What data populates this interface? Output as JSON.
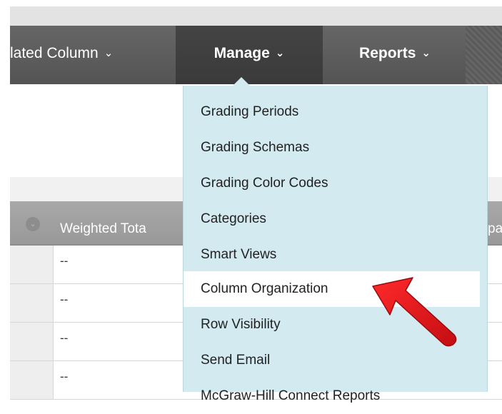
{
  "nav": {
    "calculated_column_label": "lated Column",
    "manage_label": "Manage",
    "reports_label": "Reports",
    "chevron": "⌄"
  },
  "grid": {
    "header_label": "Weighted Tota",
    "header_right_label": "pa",
    "rows": [
      "--",
      "--",
      "--",
      "--"
    ]
  },
  "manage_menu": {
    "items": [
      "Grading Periods",
      "Grading Schemas",
      "Grading Color Codes",
      "Categories",
      "Smart Views",
      "Column Organization",
      "Row Visibility",
      "Send Email",
      "McGraw-Hill Connect Reports"
    ],
    "highlighted_item": "Column Organization"
  },
  "colors": {
    "nav_bg": "#595959",
    "nav_active": "#3d3d3d",
    "menu_bg": "#d2eaf0",
    "arrow": "#e0141b"
  }
}
